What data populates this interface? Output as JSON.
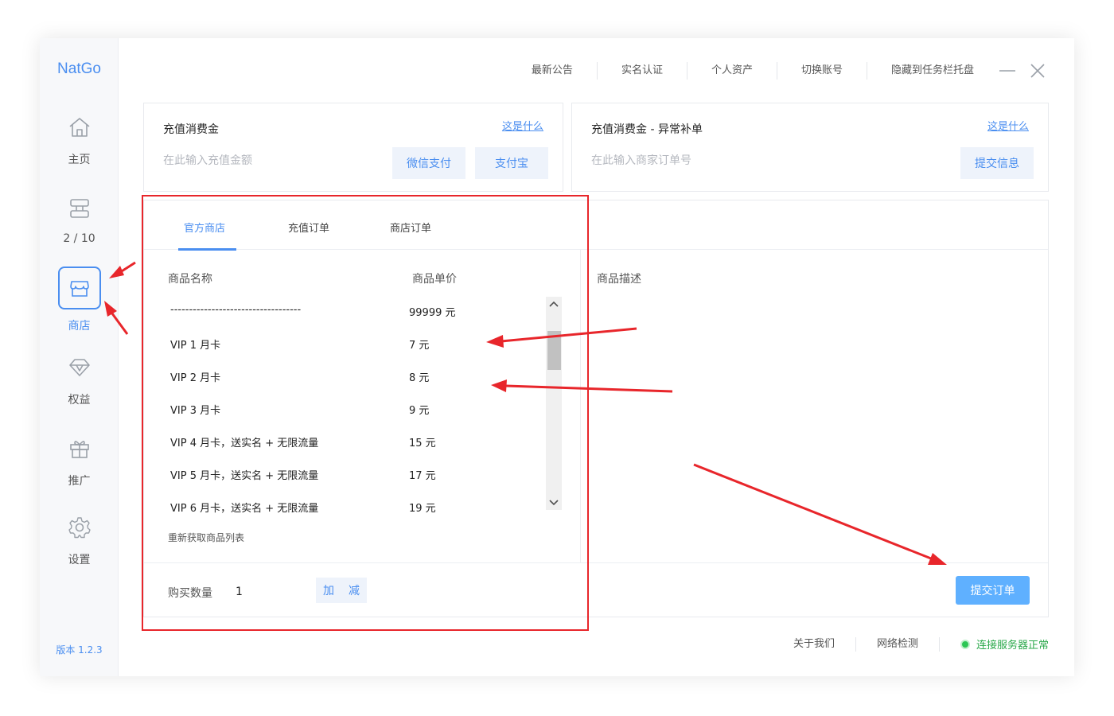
{
  "app": {
    "logo": "NatGo",
    "version": "版本 1.2.3"
  },
  "sidebar": {
    "items": [
      {
        "label": "主页",
        "icon": "home-icon"
      },
      {
        "label": "2 / 10",
        "icon": "server-icon"
      },
      {
        "label": "商店",
        "icon": "store-icon",
        "active": true
      },
      {
        "label": "权益",
        "icon": "diamond-icon"
      },
      {
        "label": "推广",
        "icon": "gift-icon"
      },
      {
        "label": "设置",
        "icon": "gear-icon"
      }
    ]
  },
  "topbar": {
    "links": [
      "最新公告",
      "实名认证",
      "个人资产",
      "切换账号",
      "隐藏到任务栏托盘"
    ],
    "minimize_icon": "minimize-icon",
    "close_icon": "close-icon"
  },
  "recharge_card": {
    "title": "充值消费金",
    "help": "这是什么",
    "placeholder": "在此输入充值金额",
    "wechat_button": "微信支付",
    "alipay_button": "支付宝"
  },
  "supplement_card": {
    "title": "充值消费金 - 异常补单",
    "help": "这是什么",
    "placeholder": "在此输入商家订单号",
    "submit_button": "提交信息"
  },
  "shop": {
    "tabs": [
      "官方商店",
      "充值订单",
      "商店订单"
    ],
    "active_tab": 0,
    "columns": {
      "name": "商品名称",
      "price": "商品单价",
      "description": "商品描述"
    },
    "products": [
      {
        "name": "-----------------------------------",
        "price": "99999 元"
      },
      {
        "name": "VIP 1 月卡",
        "price": "7 元"
      },
      {
        "name": "VIP 2 月卡",
        "price": "8 元"
      },
      {
        "name": "VIP 3 月卡",
        "price": "9 元"
      },
      {
        "name": "VIP 4 月卡，送实名 + 无限流量",
        "price": "15 元"
      },
      {
        "name": "VIP 5 月卡，送实名 + 无限流量",
        "price": "17 元"
      },
      {
        "name": "VIP 6 月卡，送实名 + 无限流量",
        "price": "19 元"
      }
    ],
    "refresh": "重新获取商品列表",
    "quantity_label": "购买数量",
    "quantity": "1",
    "add_button": "加",
    "subtract_button": "减",
    "submit_order": "提交订单"
  },
  "statusbar": {
    "about": "关于我们",
    "network_check": "网络检测",
    "connection": "连接服务器正常"
  },
  "colors": {
    "accent": "#4a8ef0",
    "submit": "#5fb0ff",
    "ok": "#2bc654",
    "annotation": "#e8262b"
  }
}
